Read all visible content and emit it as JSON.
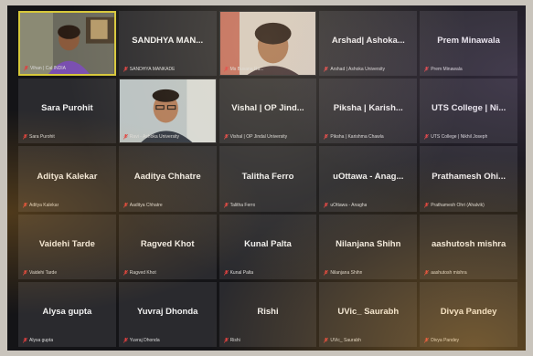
{
  "participants": [
    {
      "name": "",
      "sub": "Vihan | Cal INDIA",
      "video": "woman-home"
    },
    {
      "name": "SANDHYA MAN...",
      "sub": "SANDHYA MANKADE",
      "video": ""
    },
    {
      "name": "",
      "sub": "Ms Buvana Ra...",
      "video": "woman-closeup"
    },
    {
      "name": "Arshad| Ashoka...",
      "sub": "Arshad | Ashoka University",
      "video": ""
    },
    {
      "name": "Prem Minawala",
      "sub": "Prem Minawala",
      "video": ""
    },
    {
      "name": "Sara Purohit",
      "sub": "Sara Purohit",
      "video": ""
    },
    {
      "name": "",
      "sub": "Ravi - Ashoka University",
      "video": "man-glasses"
    },
    {
      "name": "Vishal | OP Jind...",
      "sub": "Vishal | OP Jindal University",
      "video": ""
    },
    {
      "name": "Piksha | Karish...",
      "sub": "Piksha | Karishma Chawla",
      "video": ""
    },
    {
      "name": "UTS College | Ni...",
      "sub": "UTS College | Nikhil Joseph",
      "video": ""
    },
    {
      "name": "Aditya Kalekar",
      "sub": "Aditya Kalekar",
      "video": ""
    },
    {
      "name": "Aaditya Chhatre",
      "sub": "Aaditya Chhatre",
      "video": ""
    },
    {
      "name": "Talitha Ferro",
      "sub": "Talitha Ferro",
      "video": ""
    },
    {
      "name": "uOttawa - Anag...",
      "sub": "uOttawa - Anagha",
      "video": ""
    },
    {
      "name": "Prathamesh Ohi...",
      "sub": "Prathamesh Ohri (Ahalvik)",
      "video": ""
    },
    {
      "name": "Vaidehi Tarde",
      "sub": "Vaidehi Tarde",
      "video": ""
    },
    {
      "name": "Ragved Khot",
      "sub": "Ragved Khot",
      "video": ""
    },
    {
      "name": "Kunal Palta",
      "sub": "Kunal Palta",
      "video": ""
    },
    {
      "name": "Nilanjana Shihn",
      "sub": "Nilanjana Shihn",
      "video": ""
    },
    {
      "name": "aashutosh mishra",
      "sub": "aashutosh mishra",
      "video": ""
    },
    {
      "name": "Alysa gupta",
      "sub": "Alysa gupta",
      "video": ""
    },
    {
      "name": "Yuvraj Dhonda",
      "sub": "Yuvraj Dhonda",
      "video": ""
    },
    {
      "name": "Rishi",
      "sub": "Rishi",
      "video": ""
    },
    {
      "name": "UVic_ Saurabh",
      "sub": "UVic_ Saurabh",
      "video": ""
    },
    {
      "name": "Divya Pandey",
      "sub": "Divya Pandey",
      "video": ""
    }
  ],
  "active_index": 0,
  "colors": {
    "active_border": "#d7c83a",
    "tile_bg": "#2a2a2e",
    "muted_mic": "#e04040"
  }
}
